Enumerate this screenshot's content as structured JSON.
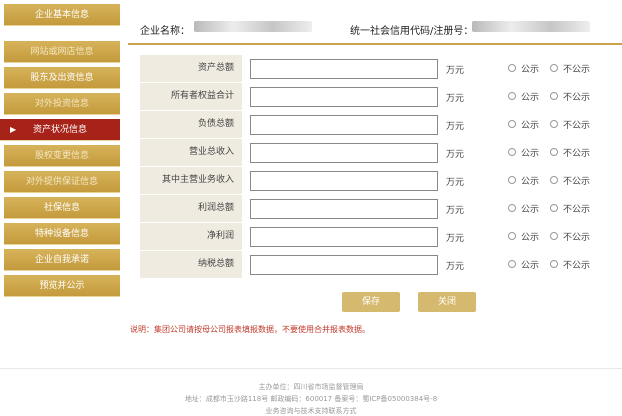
{
  "sidebar": {
    "items": [
      {
        "label": "企业基本信息"
      },
      {
        "label": "网站或网店信息"
      },
      {
        "label": "股东及出资信息"
      },
      {
        "label": "对外投资信息"
      },
      {
        "label": "资产状况信息"
      },
      {
        "label": "股权变更信息"
      },
      {
        "label": "对外提供保证信息"
      },
      {
        "label": "社保信息"
      },
      {
        "label": "特种设备信息"
      },
      {
        "label": "企业自我承诺"
      },
      {
        "label": "预览并公示"
      }
    ],
    "active_index": 4
  },
  "header": {
    "company_label": "企业名称：",
    "credit_label": "统一社会信用代码/注册号："
  },
  "form": {
    "rows": [
      {
        "label": "资产总额",
        "unit": "万元",
        "public": "公示",
        "private": "不公示"
      },
      {
        "label": "所有者权益合计",
        "unit": "万元",
        "public": "公示",
        "private": "不公示"
      },
      {
        "label": "负债总额",
        "unit": "万元",
        "public": "公示",
        "private": "不公示"
      },
      {
        "label": "营业总收入",
        "unit": "万元",
        "public": "公示",
        "private": "不公示"
      },
      {
        "label": "其中主营业务收入",
        "unit": "万元",
        "public": "公示",
        "private": "不公示"
      },
      {
        "label": "利润总额",
        "unit": "万元",
        "public": "公示",
        "private": "不公示"
      },
      {
        "label": "净利润",
        "unit": "万元",
        "public": "公示",
        "private": "不公示"
      },
      {
        "label": "纳税总额",
        "unit": "万元",
        "public": "公示",
        "private": "不公示"
      }
    ]
  },
  "buttons": {
    "save": "保存",
    "close": "关闭"
  },
  "note": "说明：集团公司请按母公司报表填报数据，不要使用合并报表数据。",
  "footer": {
    "sponsor": "主办单位：四川省市场监督管理局",
    "address": "地址：成都市玉沙路118号 邮政编码：600017 备案号：蜀ICP备05000384号-8",
    "contact": "业务咨询与技术支持联系方式"
  },
  "colors": {
    "gold": "#c49a3c",
    "active": "#a7231a",
    "label_bg": "#efebe1"
  }
}
